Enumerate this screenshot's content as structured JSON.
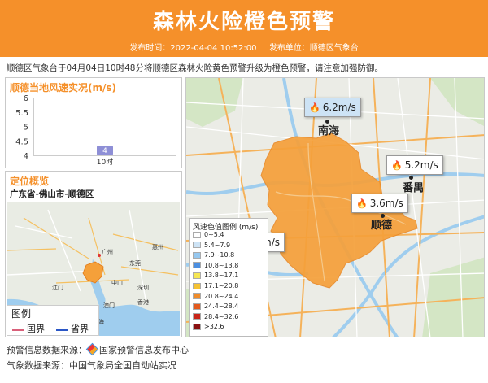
{
  "header": {
    "title": "森林火险橙色预警",
    "publish_time": "发布时间：2022-04-04 10:52:00",
    "publisher": "发布单位：顺德区气象台"
  },
  "summary": "顺德区气象台于04月04日10时48分将顺德区森林火险黄色预警升级为橙色预警，请注意加强防御。",
  "wind_panel": {
    "title": "顺德当地风速实况(m/s)",
    "chart_data": {
      "type": "bar",
      "categories": [
        "10时"
      ],
      "values": [
        4
      ],
      "ylim": [
        4,
        6
      ],
      "yticks": [
        "6",
        "5.5",
        "5",
        "4.5",
        "4"
      ],
      "value_label": "4",
      "bar_color": "#8e8fd6"
    }
  },
  "location_panel": {
    "title": "定位概览",
    "path": "广东省-佛山市-顺德区",
    "map_labels": {
      "guangzhou": "广州",
      "dongguan": "东莞",
      "shenzhen": "深圳",
      "huizhou": "惠州",
      "zhuhai": "珠海",
      "jiangmen": "江门",
      "hongkong": "香港",
      "macau": "澳门",
      "zhongshan": "中山"
    },
    "legend": {
      "title": "图例",
      "items": [
        {
          "label": "国界",
          "color": "#d9607a"
        },
        {
          "label": "省界",
          "color": "#2a56c6"
        }
      ]
    }
  },
  "main_map": {
    "cities": {
      "nanhai": "南海",
      "panyu": "番禺",
      "shunde": "顺德"
    },
    "wind_labels": {
      "nanhai": "6.2m/s",
      "panyu": "5.2m/s",
      "shunde": "3.6m/s",
      "hidden": "m/s"
    },
    "region_color": "#f5a03a",
    "scale": {
      "title": "风速色值图例 (m/s)",
      "items": [
        {
          "label": "0~5.4",
          "color": "#ffffff"
        },
        {
          "label": "5.4~7.9",
          "color": "#cde3f5"
        },
        {
          "label": "7.9~10.8",
          "color": "#96c8f0"
        },
        {
          "label": "10.8~13.8",
          "color": "#4c8fe0"
        },
        {
          "label": "13.8~17.1",
          "color": "#f5e653"
        },
        {
          "label": "17.1~20.8",
          "color": "#f5c233"
        },
        {
          "label": "20.8~24.4",
          "color": "#f08c2a"
        },
        {
          "label": "24.4~28.4",
          "color": "#e35a1e"
        },
        {
          "label": "28.4~32.6",
          "color": "#c82418"
        },
        {
          "label": ">32.6",
          "color": "#8a1010"
        }
      ]
    }
  },
  "footer": {
    "warning_source_label": "预警信息数据来源：",
    "warning_source_name": "国家预警信息发布中心",
    "weather_source": "气象数据来源：中国气象局全国自动站实况"
  }
}
